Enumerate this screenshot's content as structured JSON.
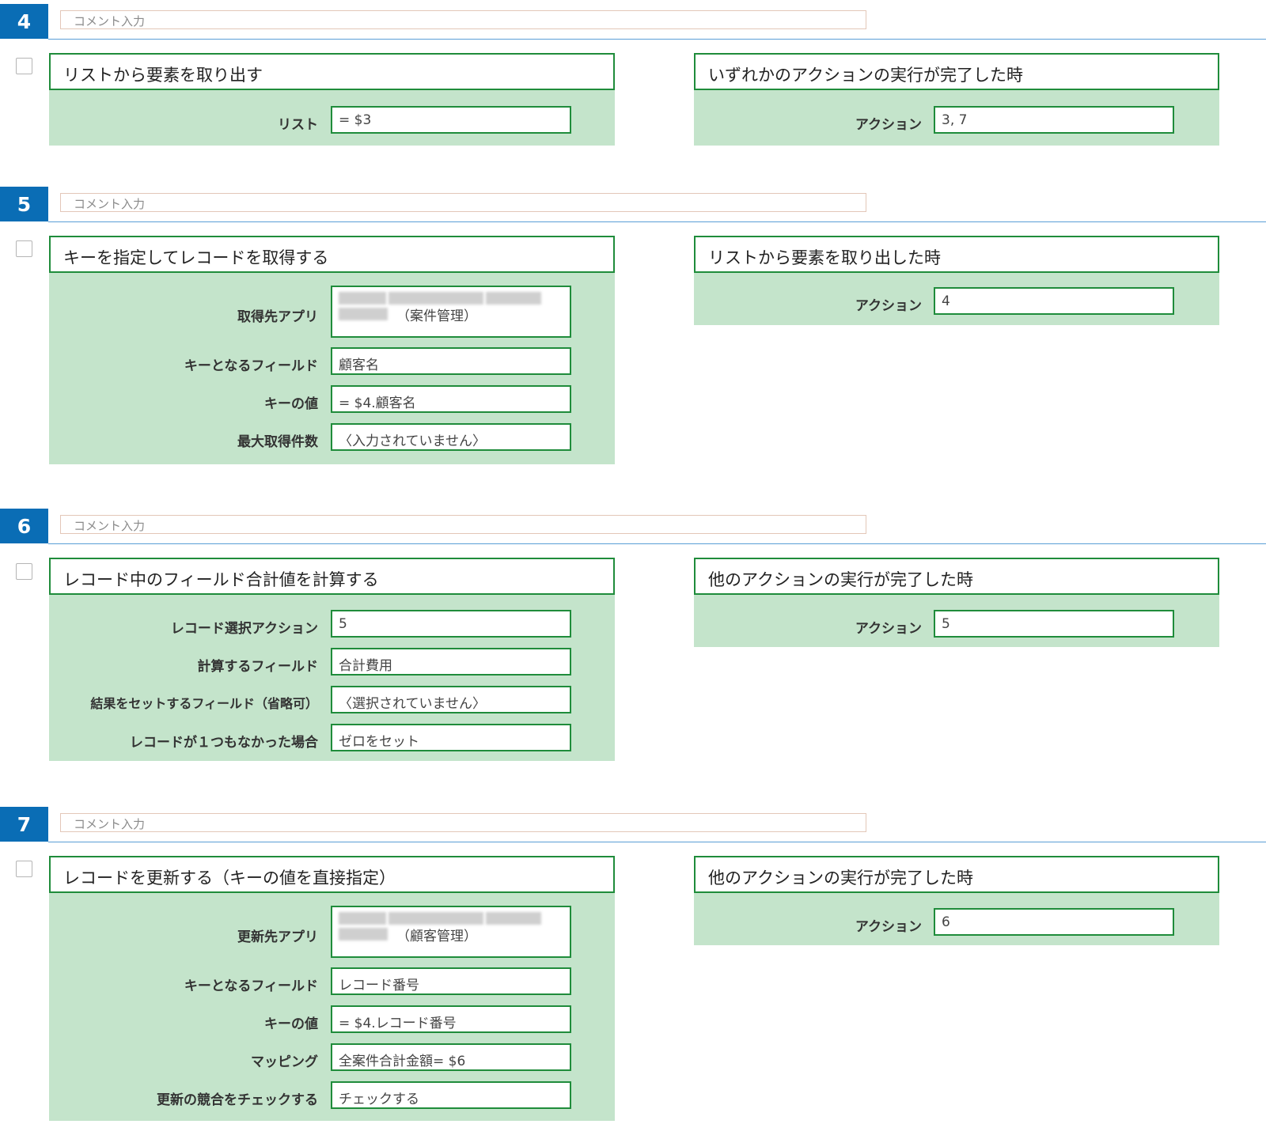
{
  "steps": [
    {
      "number": "4",
      "comment_placeholder": "コメント入力",
      "action": {
        "title": "リストから要素を取り出す",
        "fields": [
          {
            "label": "リスト",
            "value": "= $3"
          }
        ]
      },
      "trigger": {
        "title": "いずれかのアクションの実行が完了した時",
        "fields": [
          {
            "label": "アクション",
            "value": "3, 7"
          }
        ]
      }
    },
    {
      "number": "5",
      "comment_placeholder": "コメント入力",
      "action": {
        "title": "キーを指定してレコードを取得する",
        "fields": [
          {
            "label": "取得先アプリ",
            "value": "（案件管理）"
          },
          {
            "label": "キーとなるフィールド",
            "value": "顧客名"
          },
          {
            "label": "キーの値",
            "value": "= $4.顧客名"
          },
          {
            "label": "最大取得件数",
            "value": "〈入力されていません〉"
          }
        ]
      },
      "trigger": {
        "title": "リストから要素を取り出した時",
        "fields": [
          {
            "label": "アクション",
            "value": "4"
          }
        ]
      }
    },
    {
      "number": "6",
      "comment_placeholder": "コメント入力",
      "action": {
        "title": "レコード中のフィールド合計値を計算する",
        "fields": [
          {
            "label": "レコード選択アクション",
            "value": "5"
          },
          {
            "label": "計算するフィールド",
            "value": "合計費用"
          },
          {
            "label": "結果をセットするフィールド（省略可）",
            "value": "〈選択されていません〉"
          },
          {
            "label": "レコードが１つもなかった場合",
            "value": "ゼロをセット"
          }
        ]
      },
      "trigger": {
        "title": "他のアクションの実行が完了した時",
        "fields": [
          {
            "label": "アクション",
            "value": "5"
          }
        ]
      }
    },
    {
      "number": "7",
      "comment_placeholder": "コメント入力",
      "action": {
        "title": "レコードを更新する（キーの値を直接指定）",
        "fields": [
          {
            "label": "更新先アプリ",
            "value": "（顧客管理）"
          },
          {
            "label": "キーとなるフィールド",
            "value": "レコード番号"
          },
          {
            "label": "キーの値",
            "value": "= $4.レコード番号"
          },
          {
            "label": "マッピング",
            "value": "全案件合計金額= $6"
          },
          {
            "label": "更新の競合をチェックする",
            "value": "チェックする"
          }
        ]
      },
      "trigger": {
        "title": "他のアクションの実行が完了した時",
        "fields": [
          {
            "label": "アクション",
            "value": "6"
          }
        ]
      }
    }
  ]
}
